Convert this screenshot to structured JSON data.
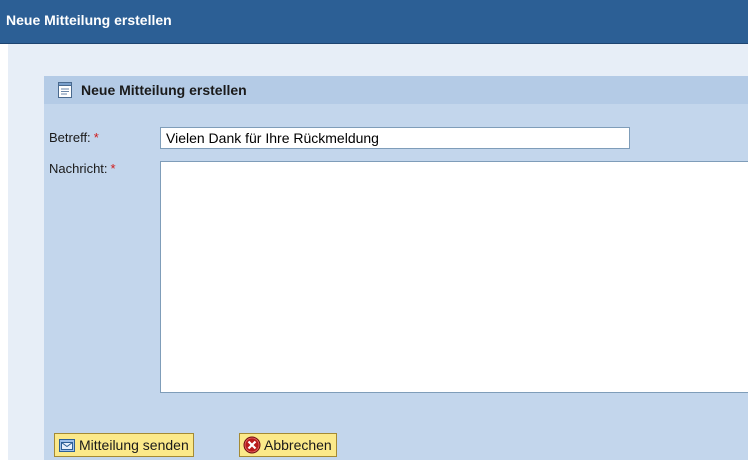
{
  "window": {
    "title": "Neue Mitteilung erstellen"
  },
  "panel": {
    "title": "Neue Mitteilung erstellen",
    "icon": "document-icon"
  },
  "form": {
    "subject": {
      "label": "Betreff:",
      "required_mark": "*",
      "value": "Vielen Dank für Ihre Rückmeldung"
    },
    "message": {
      "label": "Nachricht:",
      "required_mark": "*",
      "value": ""
    }
  },
  "buttons": {
    "send": {
      "label": "Mitteilung senden",
      "icon": "mail-send-icon"
    },
    "cancel": {
      "label": "Abbrechen",
      "icon": "cancel-icon"
    }
  },
  "colors": {
    "titlebar": "#2c5f95",
    "panel": "#c3d6ec",
    "panel_header": "#b4cbe6",
    "button": "#fbe98a",
    "required": "#d01818"
  }
}
